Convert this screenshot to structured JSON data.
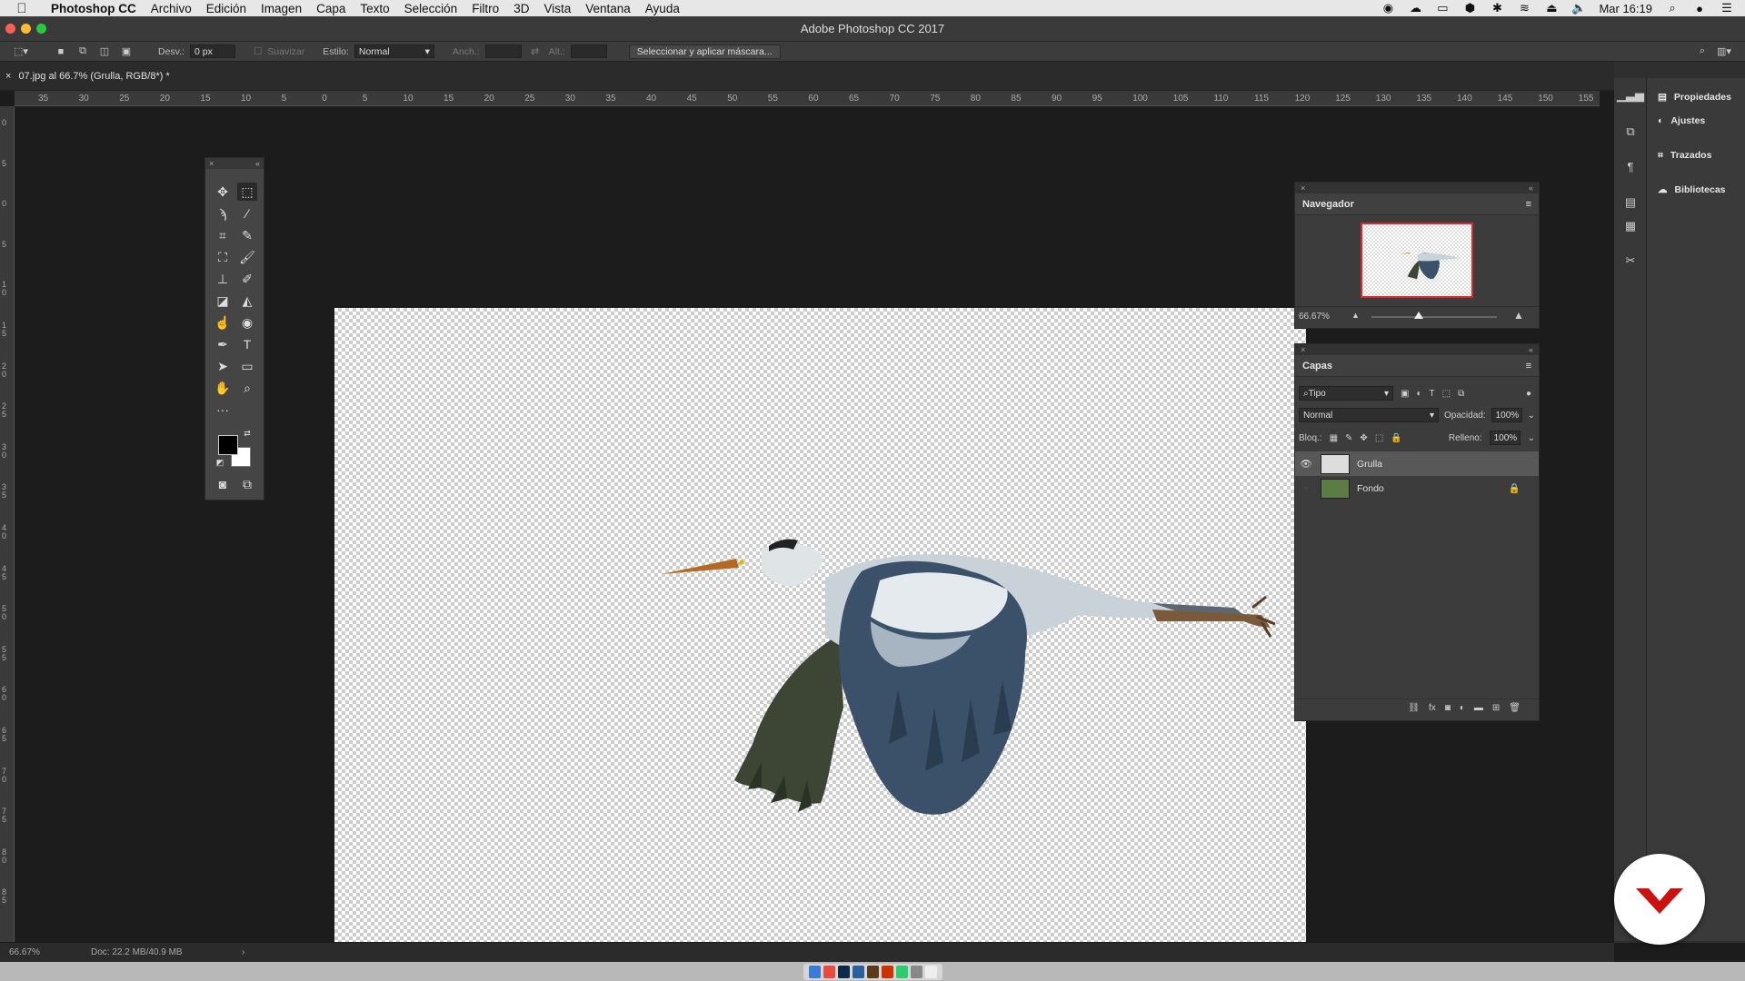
{
  "menubar": {
    "app_name": "Photoshop CC",
    "items": [
      "Archivo",
      "Edición",
      "Imagen",
      "Capa",
      "Texto",
      "Selección",
      "Filtro",
      "3D",
      "Vista",
      "Ventana",
      "Ayuda"
    ],
    "clock": "Mar 16:19"
  },
  "window": {
    "title": "Adobe Photoshop CC 2017"
  },
  "options": {
    "feather_label": "Desv.:",
    "feather_value": "0 px",
    "antialias_label": "Suavizar",
    "style_label": "Estilo:",
    "style_value": "Normal",
    "width_label": "Anch.:",
    "height_label": "Alt.:",
    "mask_button": "Seleccionar y aplicar máscara..."
  },
  "document": {
    "tab_title": "07.jpg al 66.7% (Grulla, RGB/8*) *"
  },
  "ruler": {
    "top_ticks": [
      "35",
      "30",
      "25",
      "20",
      "15",
      "10",
      "5",
      "0",
      "5",
      "10",
      "15",
      "20",
      "25",
      "30",
      "35",
      "40",
      "45",
      "50",
      "55",
      "60",
      "65",
      "70",
      "75",
      "80",
      "85",
      "90",
      "95",
      "100",
      "105",
      "110",
      "115",
      "120",
      "125",
      "130",
      "135",
      "140",
      "145",
      "150",
      "155"
    ],
    "left_ticks": [
      "0",
      "5",
      "0",
      "5",
      "1 0",
      "1 5",
      "2 0",
      "2 5",
      "3 0",
      "3 5",
      "4 0",
      "4 5",
      "5 0",
      "5 5",
      "6 0",
      "6 5",
      "7 0",
      "7 5",
      "8 0",
      "8 5"
    ]
  },
  "navigator": {
    "title": "Navegador",
    "zoom": "66.67%",
    "zoom_slider_fraction": 0.38
  },
  "layers": {
    "title": "Capas",
    "filter_value": "Tipo",
    "blend_mode": "Normal",
    "opacity_label": "Opacidad:",
    "opacity_value": "100%",
    "lock_label": "Bloq.:",
    "fill_label": "Relleno:",
    "fill_value": "100%",
    "items": [
      {
        "name": "Grulla",
        "visible": true,
        "selected": true
      },
      {
        "name": "Fondo",
        "visible": false,
        "locked": true
      }
    ]
  },
  "right_panel": {
    "items": [
      "Propiedades",
      "Ajustes",
      "Trazados",
      "Bibliotecas"
    ]
  },
  "status": {
    "zoom": "66.67%",
    "doc_info": "Doc: 22.2 MB/40.9 MB"
  },
  "icons": {
    "colors": {
      "foreground": "#000000",
      "background": "#ffffff",
      "nav_frame": "#d9282f",
      "logo": "#cc1111"
    }
  }
}
